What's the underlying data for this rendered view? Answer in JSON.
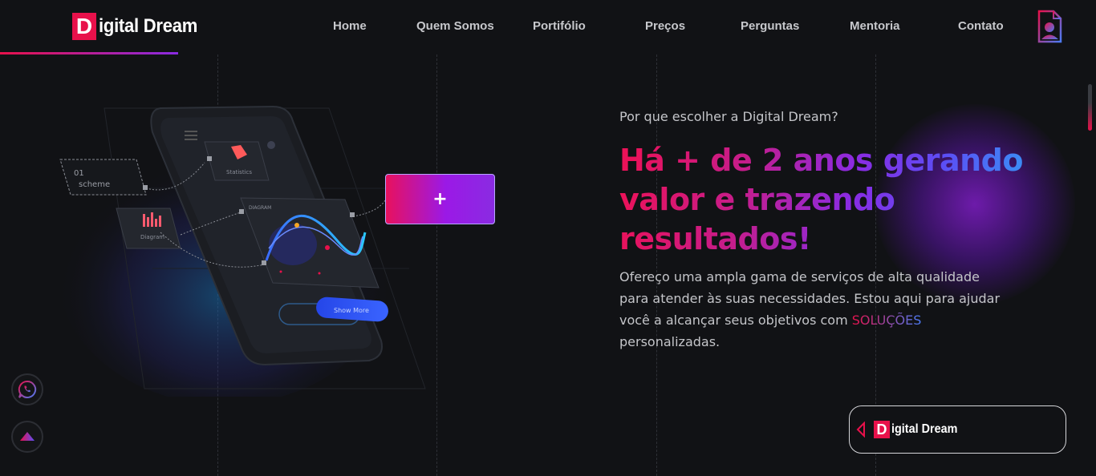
{
  "brand": {
    "logo_letter": "D",
    "logo_rest": "igital Dream"
  },
  "nav": {
    "items": [
      "Home",
      "Quem Somos",
      "Portifólio",
      "Preços",
      "Perguntas",
      "Mentoria",
      "Contato"
    ]
  },
  "hero": {
    "eyebrow": "Por que escolher a Digital Dream?",
    "headline": "Há + de 2 anos gerando valor e trazendo resultados!",
    "paragraph_before": "Ofereço uma ampla gama de serviços de alta qualidade para atender às suas necessidades. Estou aqui para ajudar você a alcançar seus objetivos com ",
    "paragraph_highlight": "SOLUÇÕES",
    "paragraph_after": " personalizadas."
  },
  "illustration": {
    "plus_label": "+",
    "scheme_label_1": "01",
    "scheme_label_2": "scheme",
    "statistics_label": "Statistics",
    "diagram_small_label": "Diagram",
    "diagram_card_label": "DIAGRAM",
    "show_more_label": "Show More"
  },
  "floating": {
    "whatsapp_icon": "whatsapp-icon",
    "scroll_top_icon": "arrow-up-icon"
  },
  "colors": {
    "accent_red": "#e8114b",
    "accent_purple": "#8a2be2",
    "accent_blue": "#2fa4f5",
    "background": "#111215"
  }
}
